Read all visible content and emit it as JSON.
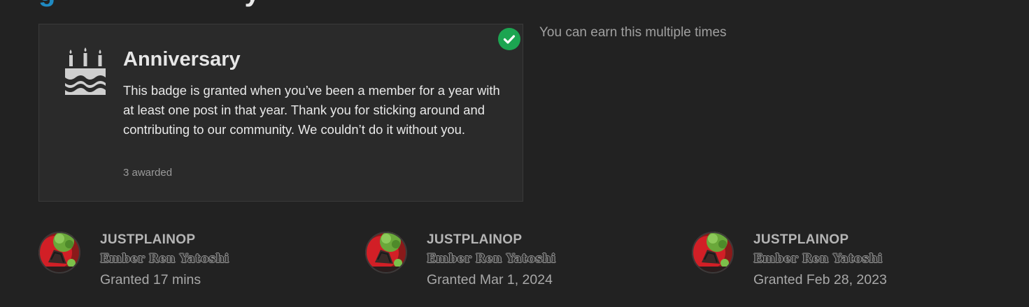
{
  "page": {
    "title_visible_part": "g",
    "title_visible_end": "y"
  },
  "badge": {
    "icon": "birthday-cake-icon",
    "name": "Anniversary",
    "description": "This badge is granted when you’ve been a member for a year with at least one post in that year. Thank you for sticking around and contributing to our community. We couldn’t do it without you.",
    "awarded": "3 awarded",
    "granted_icon": "check-circle-icon",
    "granted_color": "#1ca551",
    "accent_color": "#1f8ac2"
  },
  "earn_note": "You can earn this multiple times",
  "grantees": [
    {
      "username": "JUSTPLAINOP",
      "title": "Ember Ren Yatoshi",
      "granted": "Granted 17 mins"
    },
    {
      "username": "JUSTPLAINOP",
      "title": "Ember Ren Yatoshi",
      "granted": "Granted Mar 1, 2024"
    },
    {
      "username": "JUSTPLAINOP",
      "title": "Ember Ren Yatoshi",
      "granted": "Granted Feb 28, 2023"
    }
  ]
}
